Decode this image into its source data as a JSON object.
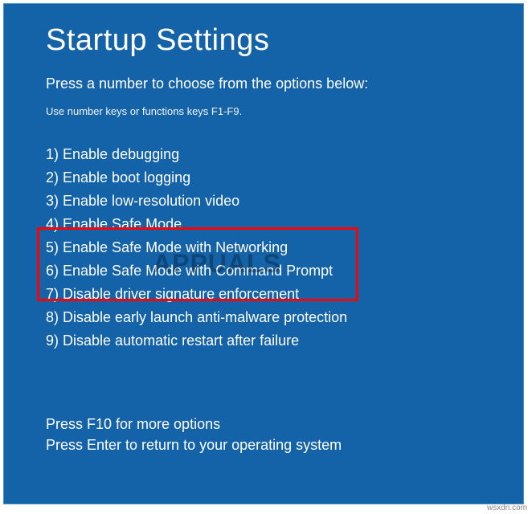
{
  "title": "Startup Settings",
  "subtitle": "Press a number to choose from the options below:",
  "hint": "Use number keys or functions keys F1-F9.",
  "options": [
    "1) Enable debugging",
    "2) Enable boot logging",
    "3) Enable low-resolution video",
    "4) Enable Safe Mode",
    "5) Enable Safe Mode with Networking",
    "6) Enable Safe Mode with Command Prompt",
    "7) Disable driver signature enforcement",
    "8) Disable early launch anti-malware protection",
    "9) Disable automatic restart after failure"
  ],
  "footer": {
    "more": "Press F10 for more options",
    "return": "Press Enter to return to your operating system"
  },
  "watermark": "APPUALS",
  "attribution": "wsxdn.com"
}
